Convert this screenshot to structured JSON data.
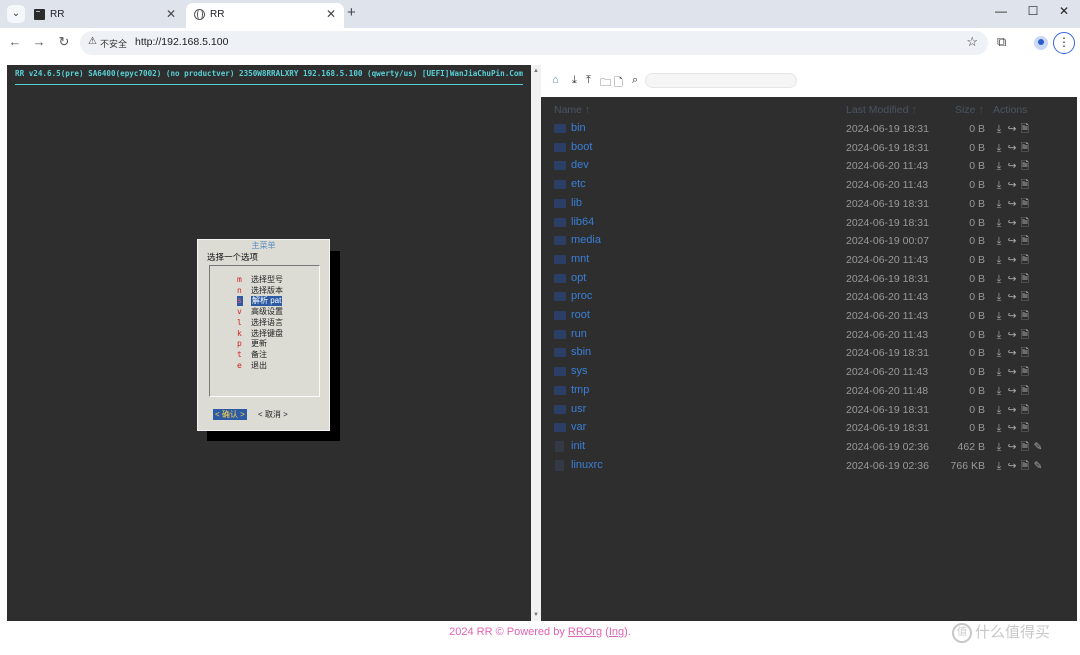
{
  "browser": {
    "tabs": [
      {
        "title": "RR",
        "favicon": "terminal-icon"
      },
      {
        "title": "RR",
        "favicon": "globe-icon"
      }
    ],
    "security_text": "不安全",
    "url": "http://192.168.5.100",
    "accent_color": "#3966d6"
  },
  "terminal": {
    "header": "RR v24.6.5(pre) SA6400(epyc7002) (no productver) 2350W8RRALXRY 192.168.5.100 (qwerty/us) [UEFI]",
    "site": "WanJiaChuPin.Com",
    "dialog": {
      "title": "主菜单",
      "prompt": "选择一个选项",
      "items": [
        {
          "key": "m",
          "label": "选择型号"
        },
        {
          "key": "n",
          "label": "选择版本"
        },
        {
          "key": "s",
          "label": "解析 pat"
        },
        {
          "key": "v",
          "label": "高级设置"
        },
        {
          "key": "l",
          "label": "选择语言"
        },
        {
          "key": "k",
          "label": "选择键盘"
        },
        {
          "key": "p",
          "label": "更新"
        },
        {
          "key": "t",
          "label": "备注"
        },
        {
          "key": "e",
          "label": "退出"
        }
      ],
      "selected_index": 2,
      "buttons": {
        "ok": "< 确认 >",
        "cancel": "< 取消 >"
      }
    }
  },
  "file_manager": {
    "columns": {
      "name": "Name",
      "modified": "Last Modified",
      "size": "Size",
      "actions": "Actions"
    },
    "rows": [
      {
        "name": "bin",
        "modified": "2024-06-19 18:31",
        "size": "0 B",
        "type": "folder"
      },
      {
        "name": "boot",
        "modified": "2024-06-19 18:31",
        "size": "0 B",
        "type": "folder"
      },
      {
        "name": "dev",
        "modified": "2024-06-20 11:43",
        "size": "0 B",
        "type": "folder"
      },
      {
        "name": "etc",
        "modified": "2024-06-20 11:43",
        "size": "0 B",
        "type": "folder"
      },
      {
        "name": "lib",
        "modified": "2024-06-19 18:31",
        "size": "0 B",
        "type": "folder"
      },
      {
        "name": "lib64",
        "modified": "2024-06-19 18:31",
        "size": "0 B",
        "type": "folder"
      },
      {
        "name": "media",
        "modified": "2024-06-19 00:07",
        "size": "0 B",
        "type": "folder"
      },
      {
        "name": "mnt",
        "modified": "2024-06-20 11:43",
        "size": "0 B",
        "type": "folder"
      },
      {
        "name": "opt",
        "modified": "2024-06-19 18:31",
        "size": "0 B",
        "type": "folder"
      },
      {
        "name": "proc",
        "modified": "2024-06-20 11:43",
        "size": "0 B",
        "type": "folder"
      },
      {
        "name": "root",
        "modified": "2024-06-20 11:43",
        "size": "0 B",
        "type": "folder"
      },
      {
        "name": "run",
        "modified": "2024-06-20 11:43",
        "size": "0 B",
        "type": "folder"
      },
      {
        "name": "sbin",
        "modified": "2024-06-19 18:31",
        "size": "0 B",
        "type": "folder"
      },
      {
        "name": "sys",
        "modified": "2024-06-20 11:43",
        "size": "0 B",
        "type": "folder"
      },
      {
        "name": "tmp",
        "modified": "2024-06-20 11:48",
        "size": "0 B",
        "type": "folder"
      },
      {
        "name": "usr",
        "modified": "2024-06-19 18:31",
        "size": "0 B",
        "type": "folder"
      },
      {
        "name": "var",
        "modified": "2024-06-19 18:31",
        "size": "0 B",
        "type": "folder"
      },
      {
        "name": "init",
        "modified": "2024-06-19 02:36",
        "size": "462 B",
        "type": "file"
      },
      {
        "name": "linuxrc",
        "modified": "2024-06-19 02:36",
        "size": "766 KB",
        "type": "file"
      }
    ]
  },
  "footer": {
    "prefix": "2024 RR © Powered by ",
    "link": "RROrg",
    "paren_open": " (",
    "link2": "Ing",
    "suffix": ")."
  },
  "watermark": "什么值得买"
}
